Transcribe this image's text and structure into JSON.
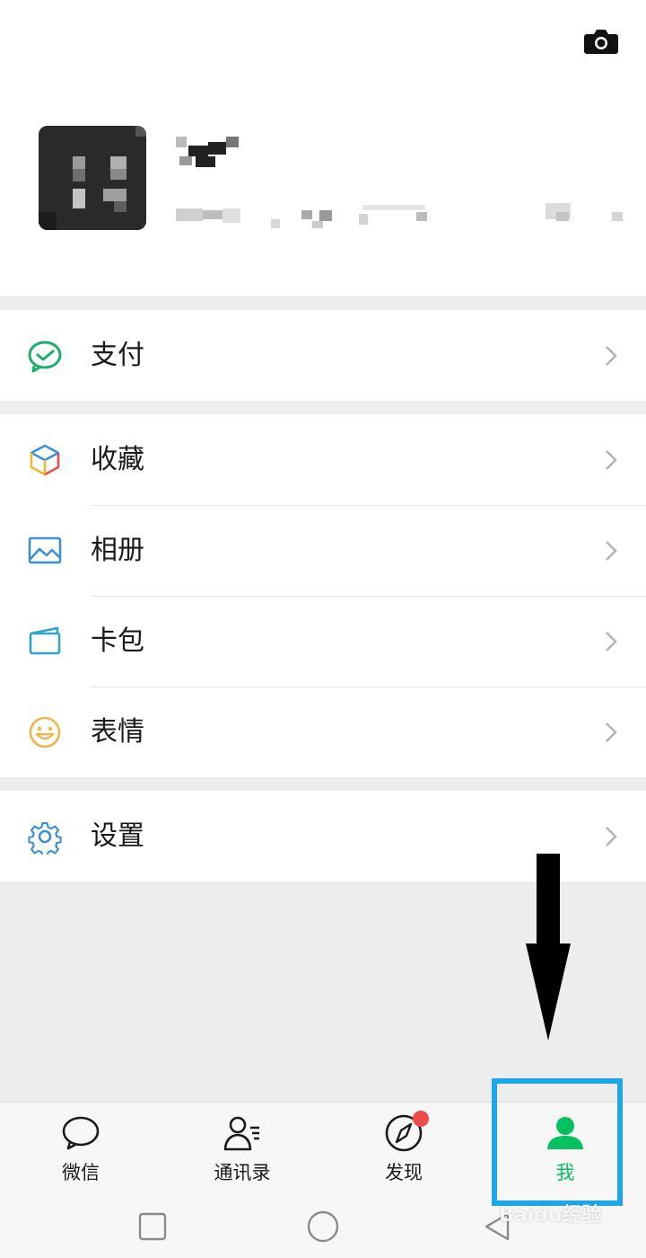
{
  "menu": {
    "pay": {
      "label": "支付",
      "icon": "wechat-pay-icon"
    },
    "favorites": {
      "label": "收藏",
      "icon": "favorites-cube-icon"
    },
    "album": {
      "label": "相册",
      "icon": "album-icon"
    },
    "cards": {
      "label": "卡包",
      "icon": "card-wallet-icon"
    },
    "stickers": {
      "label": "表情",
      "icon": "smiley-icon"
    },
    "settings": {
      "label": "设置",
      "icon": "gear-icon"
    }
  },
  "tabbar": {
    "chats": {
      "label": "微信",
      "icon": "chat-bubble-icon"
    },
    "contacts": {
      "label": "通讯录",
      "icon": "contacts-icon"
    },
    "discover": {
      "label": "发现",
      "icon": "compass-icon",
      "has_badge": true
    },
    "me": {
      "label": "我",
      "icon": "person-icon",
      "active": true
    }
  },
  "watermark": "Baidu经验",
  "colors": {
    "accent_green": "#07c160",
    "badge_red": "#f04b4b",
    "highlight_blue": "#1ea7e8",
    "background": "#ededed"
  }
}
